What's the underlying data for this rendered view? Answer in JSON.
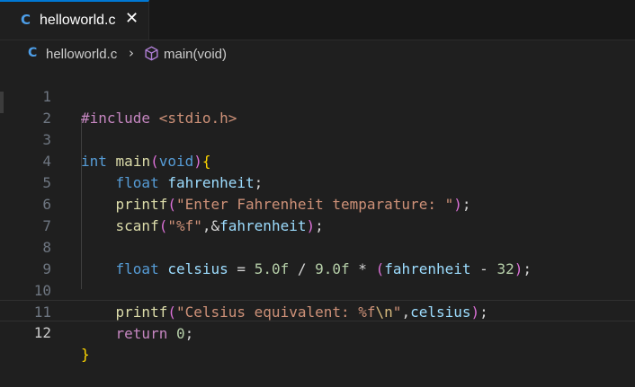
{
  "tab": {
    "icon": "c-language-icon",
    "icon_text": "C",
    "filename": "helloworld.c",
    "close_glyph": "✕"
  },
  "breadcrumb": {
    "icon_text": "C",
    "file": "helloworld.c",
    "separator": "›",
    "symbol_icon": "cube-icon",
    "function": "main(void)"
  },
  "editor": {
    "current_line": 12,
    "line_numbers": [
      "1",
      "2",
      "3",
      "4",
      "5",
      "6",
      "7",
      "8",
      "9",
      "10",
      "11",
      "12"
    ],
    "code": {
      "l1": {
        "directive": "#include",
        "header": " <stdio.h>"
      },
      "l3": {
        "type": "int",
        "name": "main",
        "open": "(",
        "param": "void",
        "close": ")",
        "brace": "{"
      },
      "l4": {
        "type": "float",
        "var": "fahrenheit",
        "semi": ";"
      },
      "l5": {
        "fn": "printf",
        "open": "(",
        "str": "\"Enter Fahrenheit temparature: \"",
        "close": ")",
        "semi": ";"
      },
      "l6": {
        "fn": "scanf",
        "open": "(",
        "str": "\"%f\"",
        "amp": ",&",
        "var": "fahrenheit",
        "close": ")",
        "semi": ";"
      },
      "l8": {
        "type": "float",
        "var": "celsius",
        "eq": " = ",
        "n1": "5.0f",
        "div": " / ",
        "n2": "9.0f",
        "mul": " * ",
        "open": "(",
        "var2": "fahrenheit",
        "minus": " - ",
        "n3": "32",
        "close": ")",
        "semi": ";"
      },
      "l10": {
        "fn": "printf",
        "open": "(",
        "str1": "\"Celsius equivalent: %f",
        "esc": "\\n",
        "str2": "\"",
        "comma": ",",
        "var": "celsius",
        "close": ")",
        "semi": ";"
      },
      "l11": {
        "kw": "return",
        "num": "0",
        "semi": ";"
      },
      "l12": {
        "brace": "}"
      }
    }
  },
  "colors": {
    "accent": "#0078d4",
    "background": "#1f1f1f",
    "keyword": "#569cd6",
    "string": "#ce9178",
    "function": "#dcdcaa",
    "variable": "#9cdcfe"
  }
}
